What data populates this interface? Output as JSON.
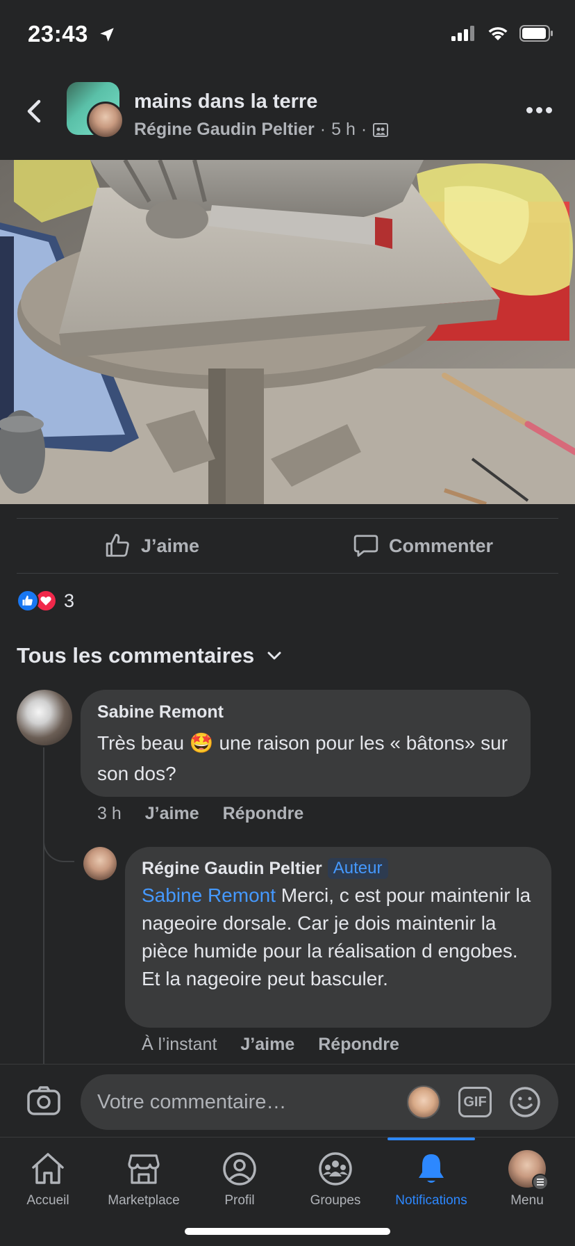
{
  "status_bar": {
    "time": "23:43"
  },
  "header": {
    "group_title": "mains dans la terre",
    "author": "Régine Gaudin Peltier",
    "separator": "·",
    "time_ago": "5 h"
  },
  "actions": {
    "like": "J’aime",
    "comment": "Commenter"
  },
  "reactions": {
    "count": "3"
  },
  "comments_filter": {
    "label": "Tous les commentaires"
  },
  "comment": {
    "author": "Sabine Remont",
    "text": "Très beau 🤩 une raison pour les « bâtons» sur son dos?",
    "time": "3 h",
    "like": "J’aime",
    "reply": "Répondre"
  },
  "reply": {
    "author": "Régine Gaudin Peltier",
    "badge": "Auteur",
    "mention": "Sabine Remont",
    "text": " Merci, c est pour maintenir la nageoire dorsale. Car je dois maintenir la pièce humide pour la réalisation d engobes. Et la nageoire peut basculer.",
    "time": "À l’instant",
    "like": "J’aime",
    "reply": "Répondre"
  },
  "composer": {
    "placeholder": "Votre commentaire…",
    "gif_label": "GIF"
  },
  "tabbar": {
    "items": [
      {
        "label": "Accueil",
        "icon": "home-icon"
      },
      {
        "label": "Marketplace",
        "icon": "marketplace-icon"
      },
      {
        "label": "Profil",
        "icon": "profile-icon"
      },
      {
        "label": "Groupes",
        "icon": "groups-icon"
      },
      {
        "label": "Notifications",
        "icon": "bell-icon",
        "active": true
      },
      {
        "label": "Menu",
        "icon": "menu-avatar"
      }
    ]
  },
  "colors": {
    "background": "#242526",
    "bubble": "#3a3b3c",
    "accent": "#2d88ff",
    "text": "#e4e6eb",
    "muted": "#b0b3b8"
  }
}
